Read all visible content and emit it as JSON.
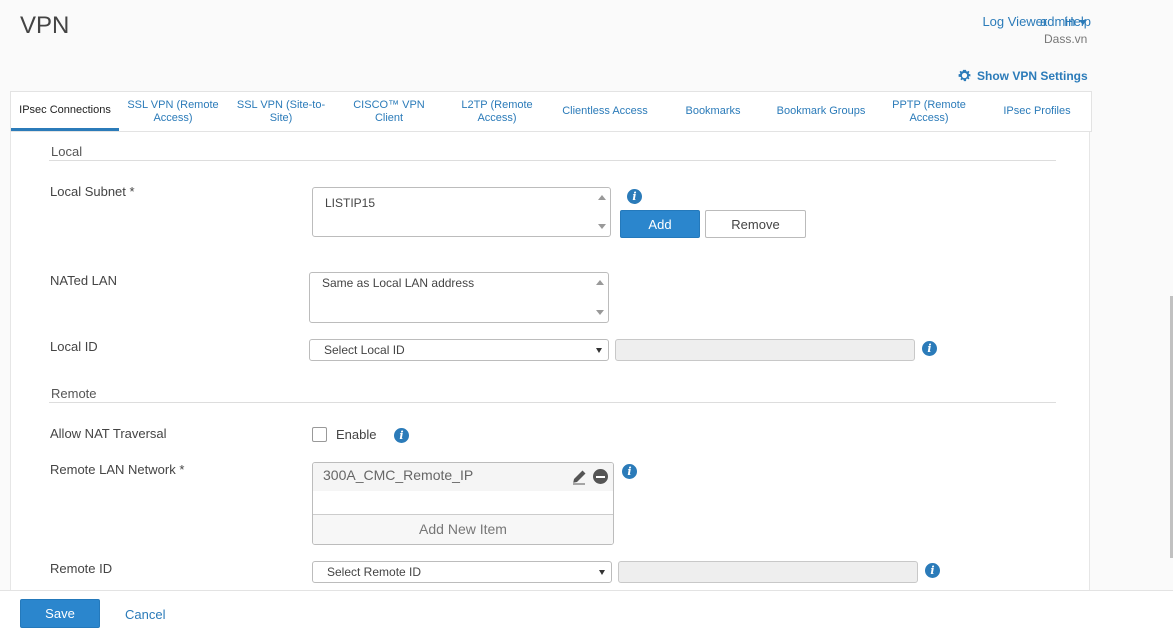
{
  "header": {
    "title": "VPN",
    "links": [
      "Log Viewer",
      "Help"
    ],
    "user": "admin",
    "company": "Dass.vn",
    "settings_link": "Show VPN Settings"
  },
  "tabs": [
    {
      "label": "IPsec Connections",
      "active": true
    },
    {
      "label": "SSL VPN (Remote Access)"
    },
    {
      "label": "SSL VPN (Site-to-Site)"
    },
    {
      "label": "CISCO™ VPN Client"
    },
    {
      "label": "L2TP (Remote Access)"
    },
    {
      "label": "Clientless Access"
    },
    {
      "label": "Bookmarks"
    },
    {
      "label": "Bookmark Groups"
    },
    {
      "label": "PPTP (Remote Access)"
    },
    {
      "label": "IPsec Profiles"
    }
  ],
  "local": {
    "section": "Local",
    "subnet_label": "Local Subnet *",
    "subnet_value": "LISTIP15",
    "add_label": "Add",
    "remove_label": "Remove",
    "nated_label": "NATed LAN",
    "nated_value": "Same as Local LAN address",
    "id_label": "Local ID",
    "id_select": "Select Local ID"
  },
  "remote": {
    "section": "Remote",
    "nat_label": "Allow NAT Traversal",
    "nat_checkbox": "Enable",
    "lan_label": "Remote LAN Network *",
    "lan_item": "300A_CMC_Remote_IP",
    "add_item": "Add New Item",
    "id_label": "Remote ID",
    "id_select": "Select Remote ID"
  },
  "footer": {
    "save": "Save",
    "cancel": "Cancel"
  },
  "icons": {
    "info": "i",
    "colors": {
      "accent": "#2b7bb9",
      "primary_button": "#2b86cd"
    }
  }
}
